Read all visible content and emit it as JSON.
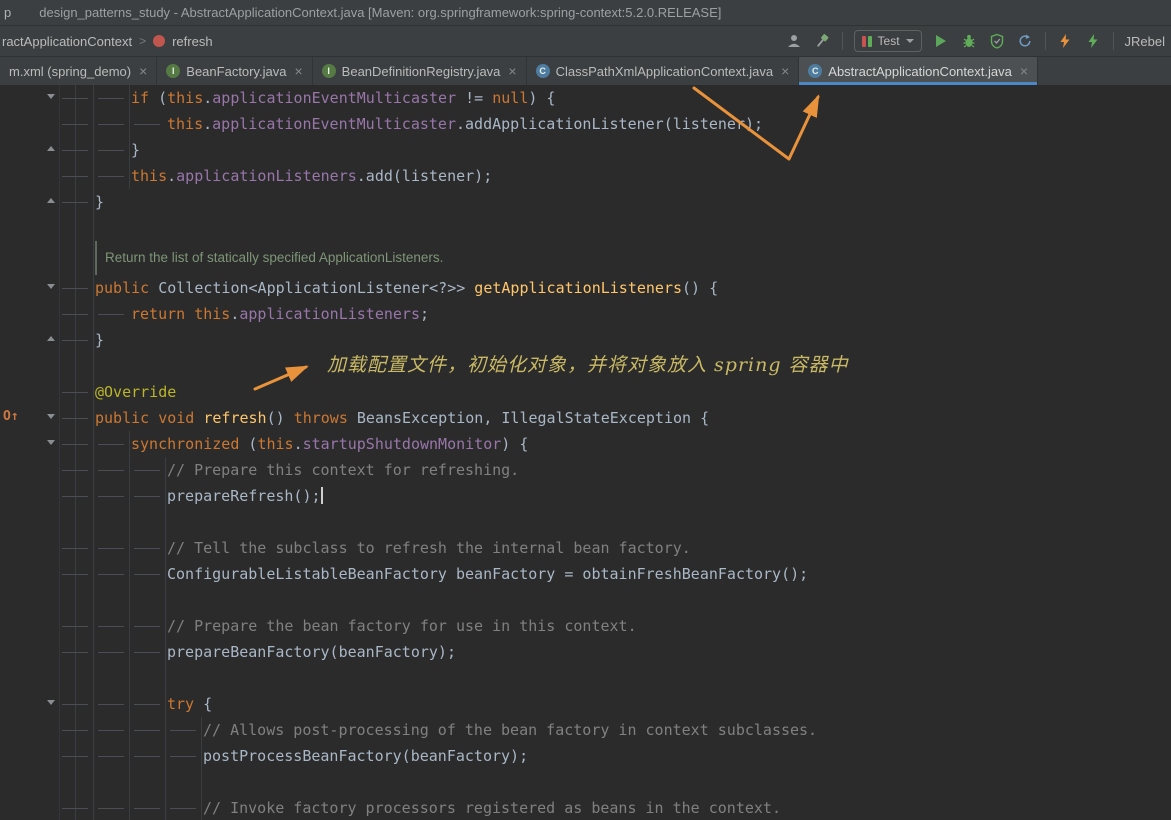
{
  "colors": {
    "arrow": "#E8923C",
    "annotation_text": "#C9B964",
    "tab_underline": "#4A88C7",
    "keyword": "#CC7832",
    "field": "#9876AA",
    "method_decl": "#FFC66B",
    "annotation_kw": "#BBB529",
    "comment": "#808080",
    "plain_text": "#A9B7C6",
    "doc_comment": "#7E9577",
    "editor_bg": "#2B2B2B",
    "chrome_bg": "#3C3F41"
  },
  "title_bar": {
    "left_text": "p",
    "title": "design_patterns_study - AbstractApplicationContext.java [Maven: org.springframework:spring-context:5.2.0.RELEASE]"
  },
  "nav_bar": {
    "breadcrumb_parent": "ractApplicationContext",
    "breadcrumb_separator": ">",
    "method_name": "refresh",
    "run_config_label": "Test",
    "jrebel_label": "JRebel",
    "toolbar_icons": [
      "user-icon",
      "build-hammer-icon",
      "test-config-icon",
      "chevron-down-icon",
      "run-icon",
      "debug-icon",
      "coverage-icon",
      "rerun-icon",
      "jrebel-run-icon",
      "jrebel-debug-icon"
    ]
  },
  "tab_bar": {
    "close_glyph": "×",
    "tabs": [
      {
        "label": "m.xml (spring_demo)",
        "icon": "xml",
        "active": false
      },
      {
        "label": "BeanFactory.java",
        "icon": "interface",
        "active": false
      },
      {
        "label": "BeanDefinitionRegistry.java",
        "icon": "interface",
        "active": false
      },
      {
        "label": "ClassPathXmlApplicationContext.java",
        "icon": "class",
        "active": false
      },
      {
        "label": "AbstractApplicationContext.java",
        "icon": "class",
        "active": true
      }
    ]
  },
  "annotation_overlay": {
    "text": "加载配置文件，初始化对象，并将对象放入 spring 容器中"
  },
  "editor": {
    "override_icon_line": 12,
    "override_icon_glyph": "O↑",
    "fold_markers": [
      {
        "line": 0,
        "dir": "down"
      },
      {
        "line": 2,
        "dir": "up"
      },
      {
        "line": 4,
        "dir": "up"
      },
      {
        "line": 7,
        "dir": "down"
      },
      {
        "line": 9,
        "dir": "up"
      },
      {
        "line": 12,
        "dir": "down"
      },
      {
        "line": 13,
        "dir": "down"
      },
      {
        "line": 23,
        "dir": "down"
      }
    ],
    "lines": [
      {
        "type": "code",
        "indent": 2,
        "tokens": [
          [
            "kw",
            "if"
          ],
          [
            "pl",
            " ("
          ],
          [
            "kw",
            "this"
          ],
          [
            "pl",
            "."
          ],
          [
            "field",
            "applicationEventMulticaster"
          ],
          [
            "pl",
            " != "
          ],
          [
            "kw",
            "null"
          ],
          [
            "pl",
            ") {"
          ]
        ]
      },
      {
        "type": "code",
        "indent": 3,
        "tokens": [
          [
            "kw",
            "this"
          ],
          [
            "pl",
            "."
          ],
          [
            "field",
            "applicationEventMulticaster"
          ],
          [
            "pl",
            ".addApplicationListener(listener);"
          ]
        ]
      },
      {
        "type": "code",
        "indent": 2,
        "tokens": [
          [
            "pl",
            "}"
          ]
        ]
      },
      {
        "type": "code",
        "indent": 2,
        "tokens": [
          [
            "kw",
            "this"
          ],
          [
            "pl",
            "."
          ],
          [
            "field",
            "applicationListeners"
          ],
          [
            "pl",
            ".add(listener);"
          ]
        ]
      },
      {
        "type": "code",
        "indent": 1,
        "tokens": [
          [
            "pl",
            "}"
          ]
        ]
      },
      {
        "type": "blank"
      },
      {
        "type": "doc",
        "text": "Return the list of statically specified ApplicationListeners."
      },
      {
        "type": "code",
        "indent": 1,
        "tokens": [
          [
            "kw",
            "public"
          ],
          [
            "pl",
            " Collection<ApplicationListener<?>> "
          ],
          [
            "mdecl",
            "getApplicationListeners"
          ],
          [
            "pl",
            "() {"
          ]
        ]
      },
      {
        "type": "code",
        "indent": 2,
        "tokens": [
          [
            "kw",
            "return"
          ],
          [
            "pl",
            " "
          ],
          [
            "kw",
            "this"
          ],
          [
            "pl",
            "."
          ],
          [
            "field",
            "applicationListeners"
          ],
          [
            "pl",
            ";"
          ]
        ]
      },
      {
        "type": "code",
        "indent": 1,
        "tokens": [
          [
            "pl",
            "}"
          ]
        ]
      },
      {
        "type": "blank"
      },
      {
        "type": "code",
        "indent": 1,
        "tokens": [
          [
            "ann",
            "@Override"
          ]
        ]
      },
      {
        "type": "code",
        "indent": 1,
        "tokens": [
          [
            "kw",
            "public"
          ],
          [
            "pl",
            " "
          ],
          [
            "kw",
            "void"
          ],
          [
            "pl",
            " "
          ],
          [
            "mdecl",
            "refresh"
          ],
          [
            "pl",
            "() "
          ],
          [
            "kw",
            "throws"
          ],
          [
            "pl",
            " BeansException, IllegalStateException {"
          ]
        ]
      },
      {
        "type": "code",
        "indent": 2,
        "tokens": [
          [
            "kw",
            "synchronized"
          ],
          [
            "pl",
            " ("
          ],
          [
            "kw",
            "this"
          ],
          [
            "pl",
            "."
          ],
          [
            "field",
            "startupShutdownMonitor"
          ],
          [
            "pl",
            ") {"
          ]
        ]
      },
      {
        "type": "code",
        "indent": 3,
        "tokens": [
          [
            "cmt",
            "// Prepare this context for refreshing."
          ]
        ]
      },
      {
        "type": "code",
        "indent": 3,
        "caret": true,
        "tokens": [
          [
            "pl",
            "prepareRefresh();"
          ]
        ]
      },
      {
        "type": "blank"
      },
      {
        "type": "code",
        "indent": 3,
        "tokens": [
          [
            "cmt",
            "// Tell the subclass to refresh the internal bean factory."
          ]
        ]
      },
      {
        "type": "code",
        "indent": 3,
        "tokens": [
          [
            "pl",
            "ConfigurableListableBeanFactory beanFactory = obtainFreshBeanFactory();"
          ]
        ]
      },
      {
        "type": "blank"
      },
      {
        "type": "code",
        "indent": 3,
        "tokens": [
          [
            "cmt",
            "// Prepare the bean factory for use in this context."
          ]
        ]
      },
      {
        "type": "code",
        "indent": 3,
        "tokens": [
          [
            "pl",
            "prepareBeanFactory(beanFactory);"
          ]
        ]
      },
      {
        "type": "blank"
      },
      {
        "type": "code",
        "indent": 3,
        "tokens": [
          [
            "kw",
            "try"
          ],
          [
            "pl",
            " {"
          ]
        ]
      },
      {
        "type": "code",
        "indent": 4,
        "tokens": [
          [
            "cmt",
            "// Allows post-processing of the bean factory in context subclasses."
          ]
        ]
      },
      {
        "type": "code",
        "indent": 4,
        "tokens": [
          [
            "pl",
            "postProcessBeanFactory(beanFactory);"
          ]
        ]
      },
      {
        "type": "blank"
      },
      {
        "type": "code",
        "indent": 4,
        "tokens": [
          [
            "cmt",
            "// Invoke factory processors registered as beans in the context."
          ]
        ]
      }
    ]
  }
}
